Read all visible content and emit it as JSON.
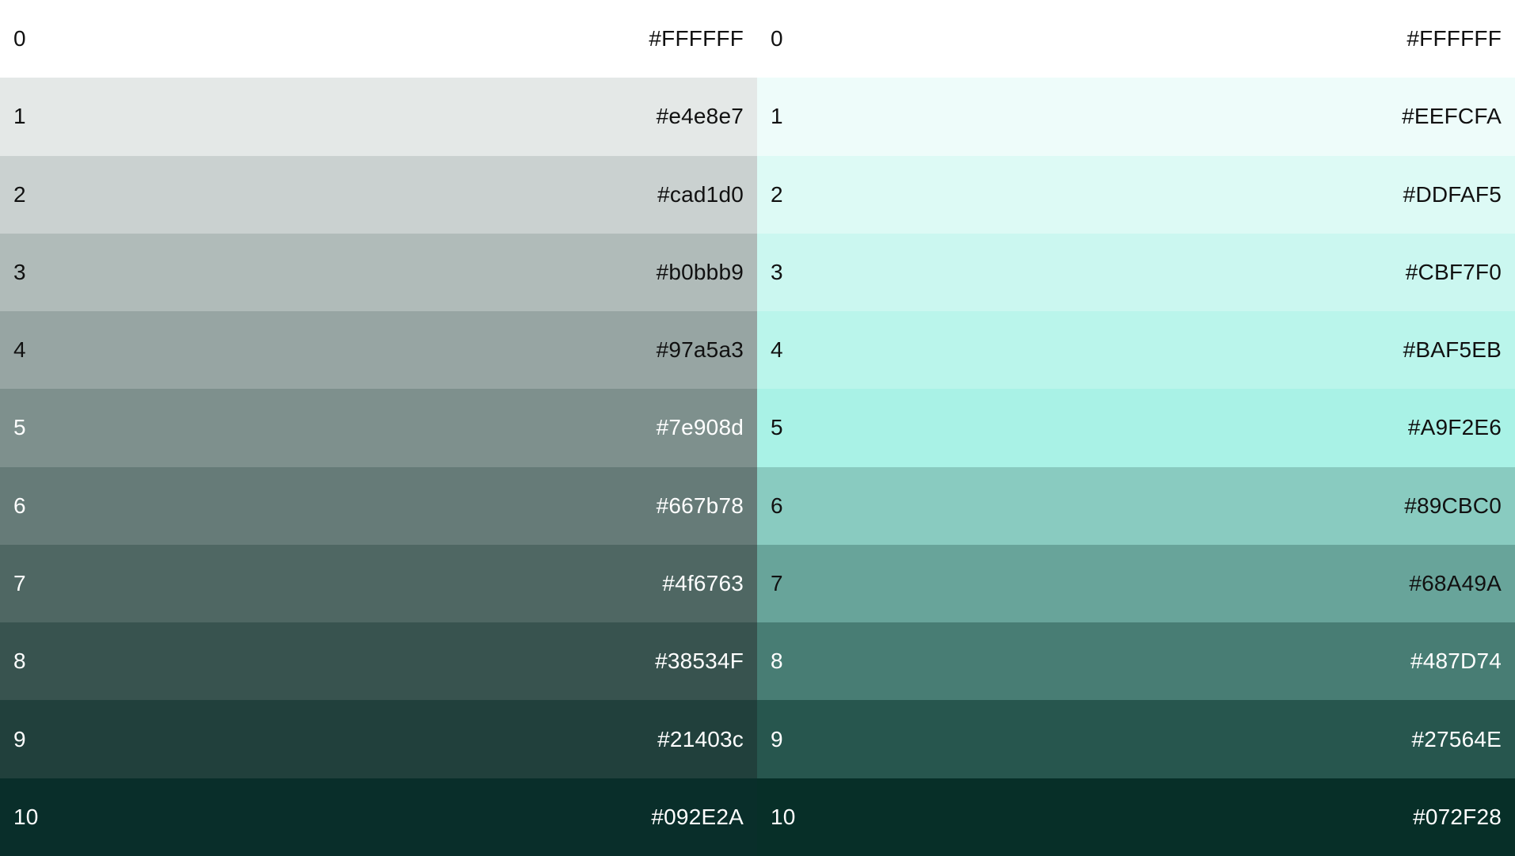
{
  "palettes": [
    {
      "swatches": [
        {
          "step": "0",
          "hex": "#FFFFFF",
          "color": "#FFFFFF",
          "text_color": "#111111"
        },
        {
          "step": "1",
          "hex": "#e4e8e7",
          "color": "#e4e8e7",
          "text_color": "#111111"
        },
        {
          "step": "2",
          "hex": "#cad1d0",
          "color": "#cad1d0",
          "text_color": "#111111"
        },
        {
          "step": "3",
          "hex": "#b0bbb9",
          "color": "#b0bbb9",
          "text_color": "#111111"
        },
        {
          "step": "4",
          "hex": "#97a5a3",
          "color": "#97a5a3",
          "text_color": "#111111"
        },
        {
          "step": "5",
          "hex": "#7e908d",
          "color": "#7e908d",
          "text_color": "#ffffff"
        },
        {
          "step": "6",
          "hex": "#667b78",
          "color": "#667b78",
          "text_color": "#ffffff"
        },
        {
          "step": "7",
          "hex": "#4f6763",
          "color": "#4f6763",
          "text_color": "#ffffff"
        },
        {
          "step": "8",
          "hex": "#38534F",
          "color": "#38534F",
          "text_color": "#ffffff"
        },
        {
          "step": "9",
          "hex": "#21403c",
          "color": "#21403c",
          "text_color": "#ffffff"
        },
        {
          "step": "10",
          "hex": "#092E2A",
          "color": "#092E2A",
          "text_color": "#ffffff"
        }
      ]
    },
    {
      "swatches": [
        {
          "step": "0",
          "hex": "#FFFFFF",
          "color": "#FFFFFF",
          "text_color": "#111111"
        },
        {
          "step": "1",
          "hex": "#EEFCFA",
          "color": "#EEFCFA",
          "text_color": "#111111"
        },
        {
          "step": "2",
          "hex": "#DDFAF5",
          "color": "#DDFAF5",
          "text_color": "#111111"
        },
        {
          "step": "3",
          "hex": "#CBF7F0",
          "color": "#CBF7F0",
          "text_color": "#111111"
        },
        {
          "step": "4",
          "hex": "#BAF5EB",
          "color": "#BAF5EB",
          "text_color": "#111111"
        },
        {
          "step": "5",
          "hex": "#A9F2E6",
          "color": "#A9F2E6",
          "text_color": "#111111"
        },
        {
          "step": "6",
          "hex": "#89CBC0",
          "color": "#89CBC0",
          "text_color": "#111111"
        },
        {
          "step": "7",
          "hex": "#68A49A",
          "color": "#68A49A",
          "text_color": "#111111"
        },
        {
          "step": "8",
          "hex": "#487D74",
          "color": "#487D74",
          "text_color": "#ffffff"
        },
        {
          "step": "9",
          "hex": "#27564E",
          "color": "#27564E",
          "text_color": "#ffffff"
        },
        {
          "step": "10",
          "hex": "#072F28",
          "color": "#072F28",
          "text_color": "#ffffff"
        }
      ]
    }
  ]
}
